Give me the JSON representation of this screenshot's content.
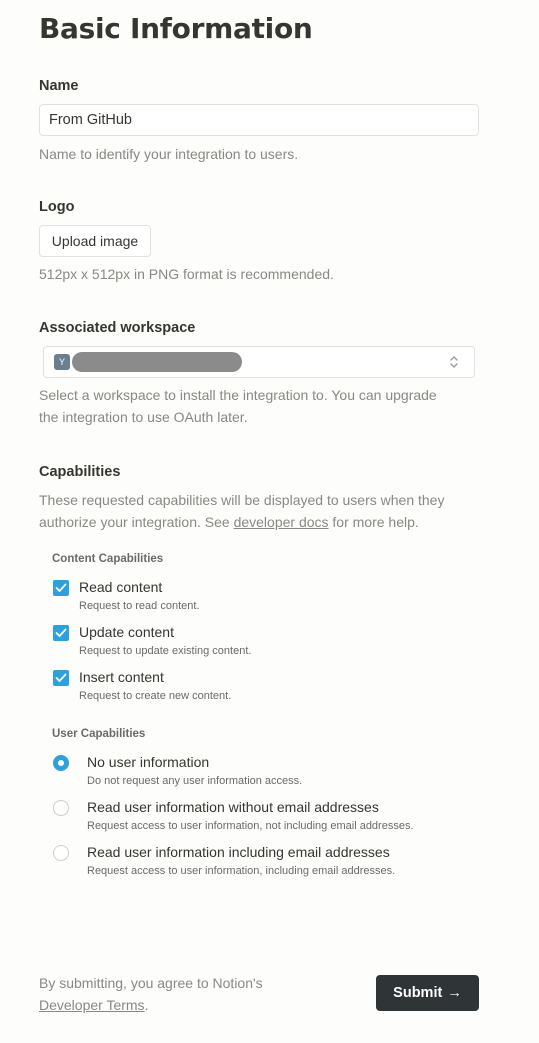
{
  "page_title": "Basic Information",
  "name_section": {
    "label": "Name",
    "value": "From GitHub",
    "help": "Name to identify your integration to users."
  },
  "logo_section": {
    "label": "Logo",
    "button_label": "Upload image",
    "help": "512px x 512px in PNG format is recommended."
  },
  "workspace_section": {
    "label": "Associated workspace",
    "avatar_letter": "Y",
    "selected_name": "",
    "help_line1": "Select a workspace to install the integration to. You can upgrade",
    "help_line2": "the integration to use OAuth later."
  },
  "capabilities": {
    "label": "Capabilities",
    "help_line1": "These requested capabilities will be displayed to users when they",
    "help_line2_prefix": "authorize your integration. See ",
    "help_link": "developer docs",
    "help_line2_suffix": " for more help.",
    "content_heading": "Content Capabilities",
    "content_items": [
      {
        "title": "Read content",
        "desc": "Request to read content.",
        "checked": true
      },
      {
        "title": "Update content",
        "desc": "Request to update existing content.",
        "checked": true
      },
      {
        "title": "Insert content",
        "desc": "Request to create new content.",
        "checked": true
      }
    ],
    "user_heading": "User Capabilities",
    "user_items": [
      {
        "title": "No user information",
        "desc": "Do not request any user information access.",
        "selected": true
      },
      {
        "title": "Read user information without email addresses",
        "desc": "Request access to user information, not including email addresses.",
        "selected": false
      },
      {
        "title": "Read user information including email addresses",
        "desc": "Request access to user information, including email addresses.",
        "selected": false
      }
    ]
  },
  "footer": {
    "line1": "By submitting, you agree to Notion's",
    "terms_link": "Developer Terms",
    "terms_suffix": ".",
    "submit_label": "Submit",
    "submit_arrow": "→"
  },
  "colors": {
    "accent": "#2ea1dc",
    "submit_bg": "#2f3437",
    "text": "#37352f",
    "muted": "#8a8883"
  }
}
